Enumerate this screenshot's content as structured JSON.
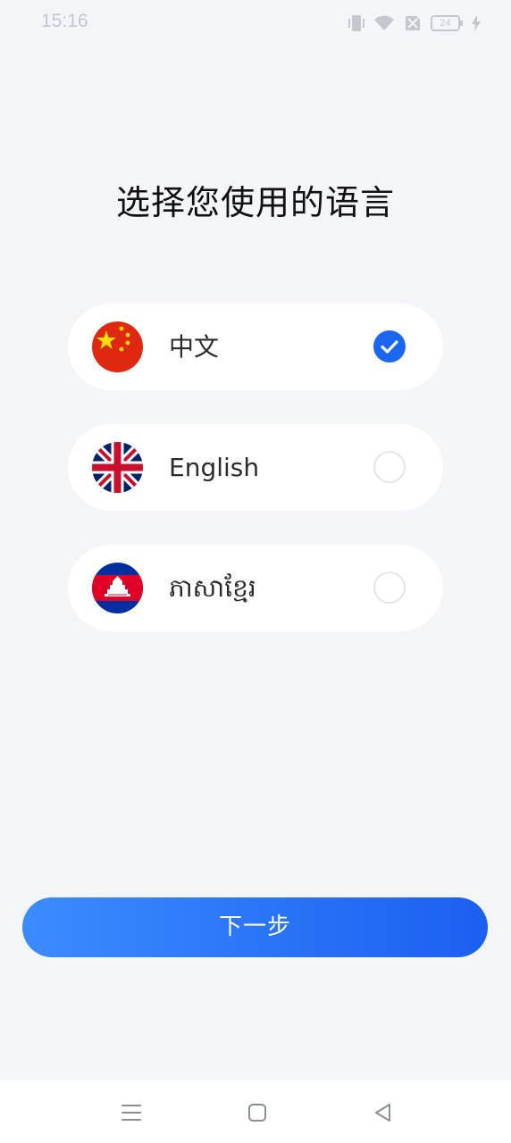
{
  "status_bar": {
    "time": "15:16",
    "battery": "24",
    "icons": [
      "vibrate-icon",
      "wifi-icon",
      "sim-off-icon",
      "battery-icon",
      "charging-icon"
    ]
  },
  "title": "选择您使用的语言",
  "languages": [
    {
      "label": "中文",
      "flag": "china-flag-icon",
      "selected": true
    },
    {
      "label": "English",
      "flag": "uk-flag-icon",
      "selected": false
    },
    {
      "label": "ភាសាខ្មែរ",
      "flag": "cambodia-flag-icon",
      "selected": false
    }
  ],
  "next_button": {
    "label": "下一步"
  },
  "nav_bar": {
    "icons": [
      "menu-icon",
      "home-icon",
      "back-icon"
    ]
  },
  "colors": {
    "accent": "#1a66f0",
    "button_gradient_start": "#3b8cff",
    "button_gradient_end": "#1b5ff0",
    "background": "#f3f5f8"
  }
}
